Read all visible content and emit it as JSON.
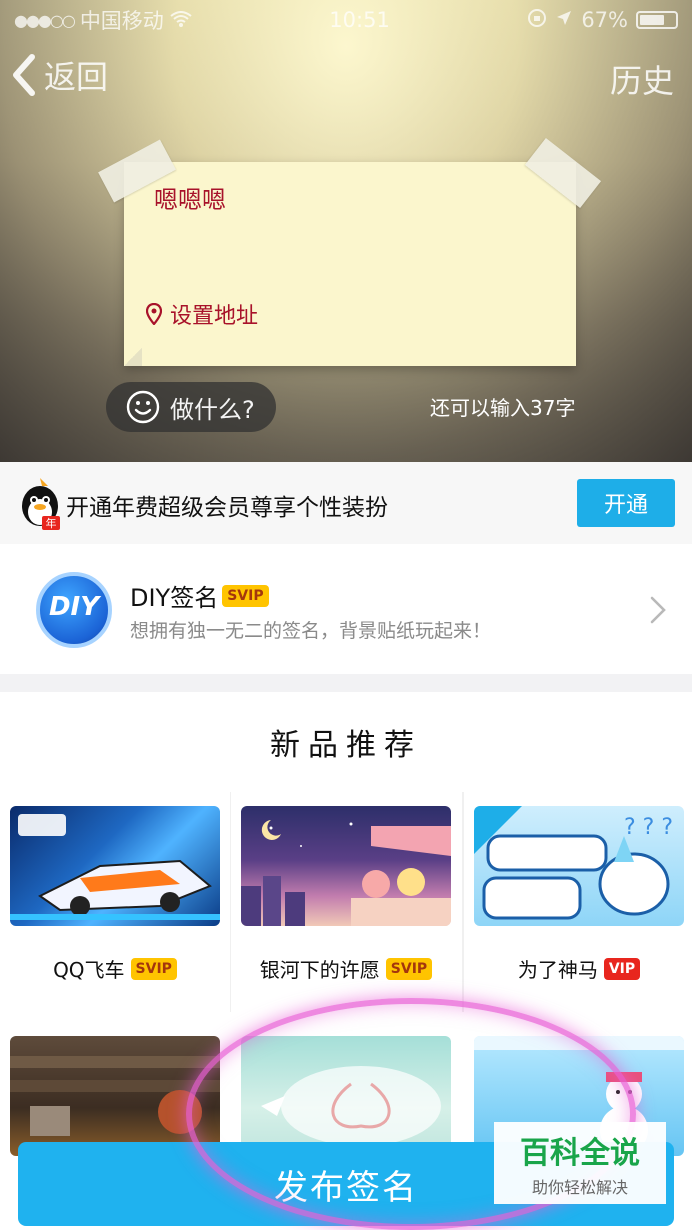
{
  "status": {
    "carrier": "中国移动",
    "time": "10:51",
    "battery": "67%"
  },
  "nav": {
    "back_label": "返回",
    "history_label": "历史"
  },
  "note": {
    "text": "嗯嗯嗯",
    "location_label": "设置地址"
  },
  "compose": {
    "do_what_label": "做什么?",
    "remaining": "还可以输入37字"
  },
  "membership": {
    "text": "开通年费超级会员尊享个性装扮",
    "open_label": "开通"
  },
  "diy": {
    "logo_text": "DIY",
    "title": "DIY签名",
    "badge": "SVIP",
    "subtitle": "想拥有独一无二的签名，背景贴纸玩起来！"
  },
  "new_products": {
    "title": "新品推荐",
    "items": [
      {
        "name": "QQ飞车",
        "badge": "SVIP"
      },
      {
        "name": "银河下的许愿",
        "badge": "SVIP"
      },
      {
        "name": "为了神马",
        "badge": "VIP"
      }
    ]
  },
  "bottom": {
    "publish_label": "发布签名"
  },
  "watermark": {
    "title": "百科全说",
    "subtitle": "助你轻松解决"
  },
  "colors": {
    "accent_blue": "#1FB2EF",
    "note_text": "#A8122A",
    "svip_bg": "#FFC400",
    "vip_bg": "#E8261E"
  }
}
